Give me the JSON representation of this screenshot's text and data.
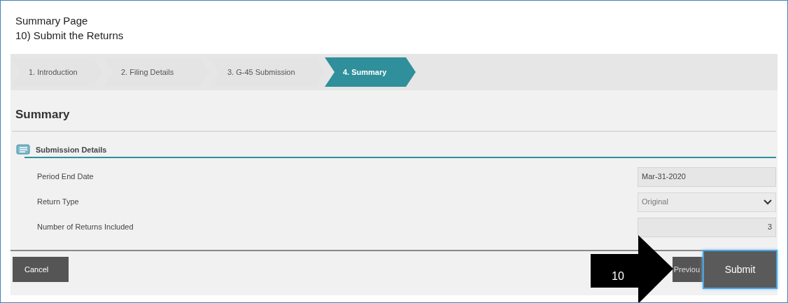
{
  "caption": {
    "title": "Summary Page",
    "subtitle": "10) Submit the Returns"
  },
  "steps": [
    {
      "label": "1. Introduction",
      "selected": false
    },
    {
      "label": "2. Filing Details",
      "selected": false
    },
    {
      "label": "3. G-45 Submission",
      "selected": false
    },
    {
      "label": "4. Summary",
      "selected": true
    }
  ],
  "heading": "Summary",
  "section": {
    "title": "Submission Details",
    "fields": [
      {
        "label": "Period End Date",
        "kind": "text",
        "value": "Mar-31-2020"
      },
      {
        "label": "Return Type",
        "kind": "select",
        "value": "Original"
      },
      {
        "label": "Number of Returns Included",
        "kind": "number",
        "value": "3"
      }
    ]
  },
  "footer": {
    "cancel": "Cancel",
    "previous": "Previou",
    "submit": "Submit"
  },
  "callout": {
    "number": "10"
  }
}
